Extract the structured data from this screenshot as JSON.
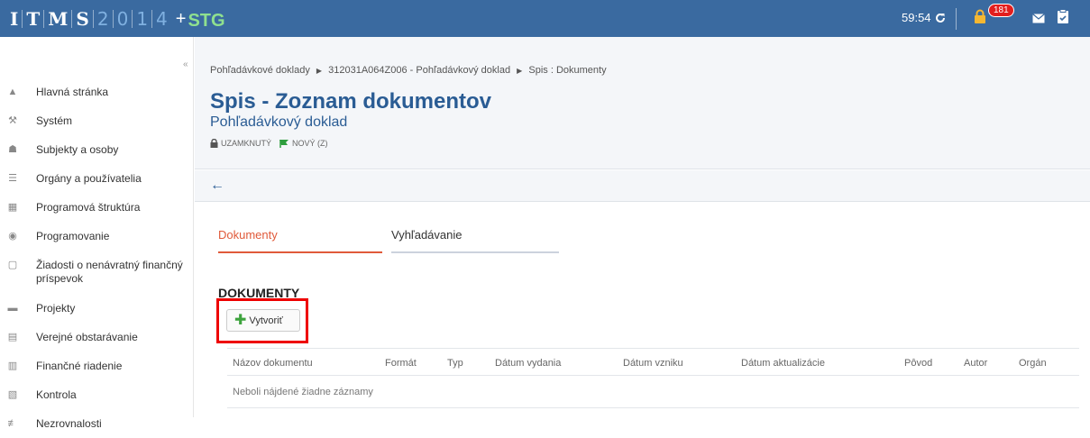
{
  "app": {
    "logo": {
      "l1": "I",
      "l2": "T",
      "l3": "M",
      "l4": "S",
      "n1": "2",
      "n2": "0",
      "n3": "1",
      "n4": "4",
      "plus": "+",
      "env": "STG"
    },
    "timer": "59:54",
    "notif_count": "181"
  },
  "sidebar": {
    "collapse": "«",
    "items": [
      {
        "label": "Hlavná stránka",
        "icon": "home-icon"
      },
      {
        "label": "Systém",
        "icon": "wrench-icon"
      },
      {
        "label": "Subjekty a osoby",
        "icon": "people-icon"
      },
      {
        "label": "Orgány a používatelia",
        "icon": "user-list-icon"
      },
      {
        "label": "Programová štruktúra",
        "icon": "sitemap-icon"
      },
      {
        "label": "Programovanie",
        "icon": "database-icon"
      },
      {
        "label": "Žiadosti o nenávratný finančný príspevok",
        "icon": "document-icon"
      },
      {
        "label": "Projekty",
        "icon": "archive-icon"
      },
      {
        "label": "Verejné obstarávanie",
        "icon": "inbox-icon"
      },
      {
        "label": "Finančné riadenie",
        "icon": "finance-icon"
      },
      {
        "label": "Kontrola",
        "icon": "checklist-icon"
      },
      {
        "label": "Nezrovnalosti",
        "icon": "warning-icon"
      }
    ]
  },
  "header": {
    "breadcrumb": [
      "Pohľadávkové doklady",
      "312031A064Z006 - Pohľadávkový doklad",
      "Spis : Dokumenty"
    ],
    "title": "Spis - Zoznam dokumentov",
    "subtitle": "Pohľadávkový doklad",
    "status_locked": "UZAMKNUTÝ",
    "status_new": "NOVÝ (Z)",
    "back": "←"
  },
  "tabs": [
    {
      "label": "Dokumenty"
    },
    {
      "label": "Vyhľadávanie"
    }
  ],
  "section": {
    "title": "DOKUMENTY",
    "create_label": "Vytvoriť"
  },
  "table": {
    "columns": [
      "Názov dokumentu",
      "Formát",
      "Typ",
      "Dátum vydania",
      "Dátum vzniku",
      "Dátum aktualizácie",
      "Pôvod",
      "Autor",
      "Orgán"
    ],
    "empty": "Neboli nájdené žiadne záznamy"
  },
  "colors": {
    "topbar": "#3a6aa0",
    "accent": "#e05a3a",
    "title": "#2a5c94",
    "highlight": "#e00000"
  }
}
